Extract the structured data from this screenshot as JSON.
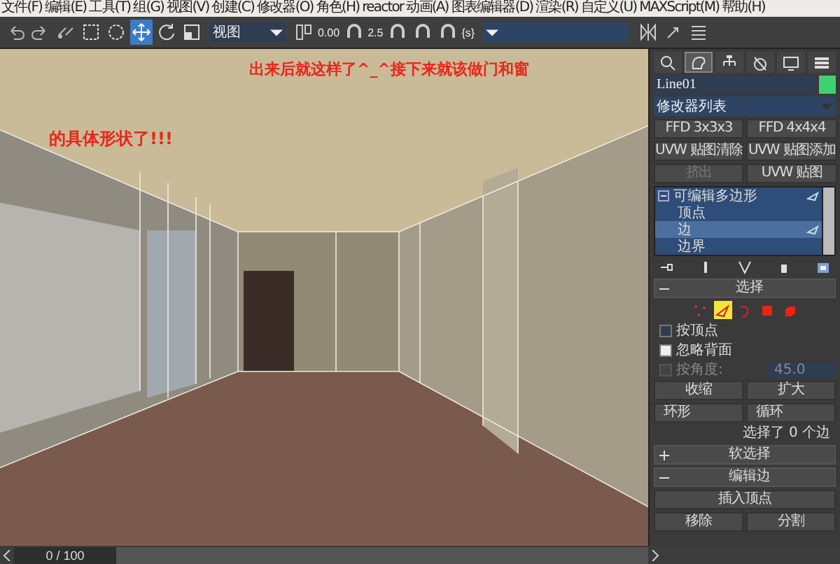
{
  "menu": [
    "文件(F)",
    "编辑(E)",
    "工具(T)",
    "组(G)",
    "视图(V)",
    "创建(C)",
    "修改器(O)",
    "角色(H)",
    "reactor",
    "动画(A)",
    "图表编辑器(D)",
    "渲染(R)",
    "自定义(U)",
    "MAXScript(M)",
    "帮助(H)"
  ],
  "toolbar": {
    "tools": [
      {
        "kind": "undo",
        "selected": false
      },
      {
        "kind": "redo",
        "selected": false
      },
      {
        "kind": "link",
        "selected": false
      },
      {
        "kind": "select",
        "selected": false
      },
      {
        "kind": "region",
        "selected": false
      },
      {
        "kind": "move",
        "selected": true
      },
      {
        "kind": "rotate",
        "selected": false
      },
      {
        "kind": "scale",
        "selected": false
      }
    ],
    "reference_coord": "视图",
    "keyboard_readout": "0.00",
    "snap_value": "2.5",
    "selection_sets": "{s}"
  },
  "caption": [
    "出来后就这样了^_^接下来就该做门和窗",
    "的具体形状了!!!"
  ],
  "command_panel": {
    "tabs": [
      {
        "kind": "create",
        "selected": false
      },
      {
        "kind": "modify",
        "selected": true
      },
      {
        "kind": "hierarchy",
        "selected": false
      },
      {
        "kind": "motion",
        "selected": false
      },
      {
        "kind": "display",
        "selected": false
      },
      {
        "kind": "utilities",
        "selected": false
      }
    ],
    "object": {
      "name": "Line01",
      "color": "#40d070"
    },
    "modifier_list": "修改器列表",
    "modifier_buttons": [
      {
        "label": "FFD 3x3x3",
        "disabled": false
      },
      {
        "label": "FFD 4x4x4",
        "disabled": false
      },
      {
        "label": "UVW 贴图清除",
        "disabled": false
      },
      {
        "label": "UVW 贴图添加",
        "disabled": false
      },
      {
        "label": "挤出",
        "disabled": true
      },
      {
        "label": "UVW 贴图",
        "disabled": false
      }
    ],
    "stack": [
      {
        "label": "可编辑多边形",
        "expanded": true,
        "selected": false,
        "children": [
          {
            "label": "顶点",
            "selected": false
          },
          {
            "label": "边",
            "selected": true
          },
          {
            "label": "边界",
            "selected": false
          }
        ]
      }
    ],
    "rollouts": [
      {
        "kind": "selection",
        "title": "选择",
        "expanded": true,
        "subobjects": [
          {
            "kind": "vertex",
            "selected": false
          },
          {
            "kind": "edge",
            "selected": true
          },
          {
            "kind": "border",
            "selected": false
          },
          {
            "kind": "polygon",
            "selected": false
          },
          {
            "kind": "element",
            "selected": false
          }
        ],
        "checks": [
          {
            "label": "按顶点",
            "checked": false
          },
          {
            "label": "忽略背面",
            "checked": true
          },
          {
            "label": "按角度:",
            "checked": false,
            "disabled": true,
            "value": "45.0"
          }
        ],
        "buttons": [
          "收缩",
          "扩大"
        ],
        "spinners": [
          "环形",
          "循环"
        ],
        "status": "选择了 0 个边"
      },
      {
        "title": "软选择",
        "expanded": false
      },
      {
        "kind": "buttons",
        "title": "编辑边",
        "expanded": true,
        "rows": [
          [
            "插入顶点"
          ],
          [
            "移除",
            "分割"
          ]
        ]
      }
    ]
  },
  "timeline": {
    "position": "0 / 100"
  }
}
